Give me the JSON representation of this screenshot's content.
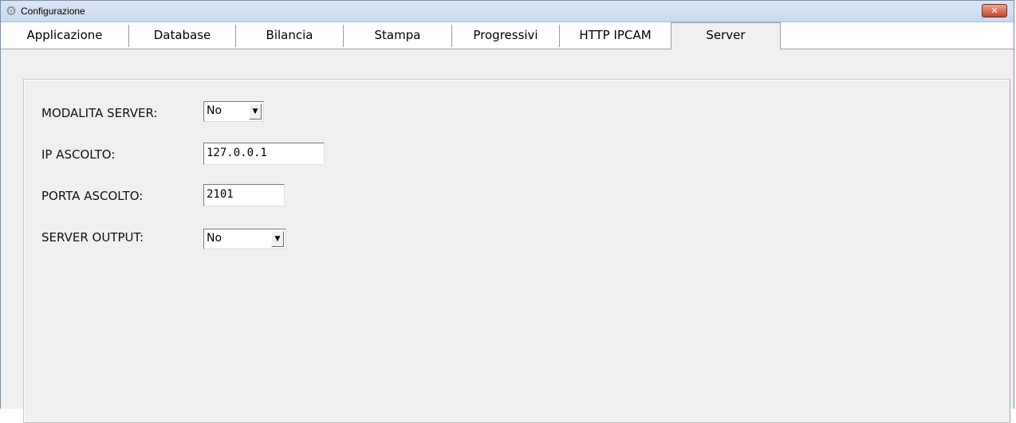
{
  "window": {
    "title": "Configurazione",
    "icon": "gear-icon",
    "close_label": "✕"
  },
  "tabs": [
    {
      "label": "Applicazione",
      "active": false
    },
    {
      "label": "Database",
      "active": false
    },
    {
      "label": "Bilancia",
      "active": false
    },
    {
      "label": "Stampa",
      "active": false
    },
    {
      "label": "Progressivi",
      "active": false
    },
    {
      "label": "HTTP IPCAM",
      "active": false
    },
    {
      "label": "Server",
      "active": true
    }
  ],
  "server": {
    "modalita_label": "MODALITA SERVER:",
    "modalita_value": "No",
    "ip_label": "IP ASCOLTO:",
    "ip_value": "127.0.0.1",
    "porta_label": "PORTA ASCOLTO:",
    "porta_value": "2101",
    "output_label": "SERVER OUTPUT:",
    "output_value": "No"
  },
  "colors": {
    "titlebar": "#c9d9ee",
    "close_button": "#c8432a",
    "panel_background": "#f0f0f0"
  }
}
